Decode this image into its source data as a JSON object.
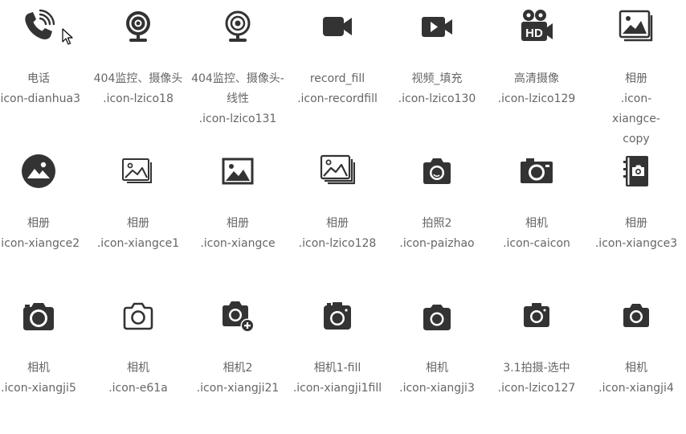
{
  "icons": [
    {
      "label": "电话",
      "code": ".icon-dianhua3",
      "icon": "phone-ringing-icon"
    },
    {
      "label": "404监控、摄像头",
      "code": ".icon-lzico18",
      "icon": "webcam-fill-icon"
    },
    {
      "label": "404监控、摄像头-线性",
      "code": ".icon-lzico131",
      "icon": "webcam-outline-icon"
    },
    {
      "label": "record_fill",
      "code": ".icon-recordfill",
      "icon": "video-camera-fill-icon"
    },
    {
      "label": "视频_填充",
      "code": ".icon-lzico130",
      "icon": "video-play-fill-icon"
    },
    {
      "label": "高清摄像",
      "code": ".icon-lzico129",
      "icon": "hd-camera-icon"
    },
    {
      "label": "相册",
      "code": ".icon-xiangce-copy",
      "icon": "album-stack-icon"
    },
    {
      "label": "相册",
      "code": ".icon-xiangce2",
      "icon": "album-circle-icon"
    },
    {
      "label": "相册",
      "code": ".icon-xiangce1",
      "icon": "album-outline-icon"
    },
    {
      "label": "相册",
      "code": ".icon-xiangce",
      "icon": "album-picture-icon"
    },
    {
      "label": "相册",
      "code": ".icon-lzico128",
      "icon": "album-layers-icon"
    },
    {
      "label": "拍照2",
      "code": ".icon-paizhao",
      "icon": "camera-shutter-icon"
    },
    {
      "label": "相机",
      "code": ".icon-caicon",
      "icon": "camera-wide-icon"
    },
    {
      "label": "相册",
      "code": ".icon-xiangce3",
      "icon": "album-notebook-icon"
    },
    {
      "label": "相机",
      "code": ".icon-xiangji5",
      "icon": "camera-fill-icon"
    },
    {
      "label": "相机",
      "code": ".icon-e61a",
      "icon": "camera-outline-icon"
    },
    {
      "label": "相机2",
      "code": ".icon-xiangji21",
      "icon": "camera-add-icon"
    },
    {
      "label": "相机1-fill",
      "code": ".icon-xiangji1fill",
      "icon": "camera-square-fill-icon"
    },
    {
      "label": "相机",
      "code": ".icon-xiangji3",
      "icon": "camera-rounded-icon"
    },
    {
      "label": "3.1拍摄-选中",
      "code": ".icon-lzico127",
      "icon": "camera-selected-icon"
    },
    {
      "label": "相机",
      "code": ".icon-xiangji4",
      "icon": "camera-compact-icon"
    }
  ]
}
